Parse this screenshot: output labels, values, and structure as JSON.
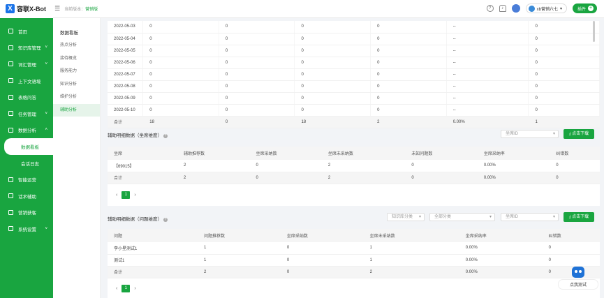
{
  "app": {
    "logo_mark": "X",
    "logo_text": "容联X-Bot",
    "crumb_label": "当前版本：",
    "crumb_version": "营销版"
  },
  "topbar": {
    "user": "xb营销六七",
    "button": "插件"
  },
  "sidebar": [
    {
      "label": "首页",
      "chev": false,
      "sub": false,
      "active": false
    },
    {
      "label": "知识库管理",
      "chev": true,
      "sub": false,
      "active": false
    },
    {
      "label": "词汇管理",
      "chev": true,
      "sub": false,
      "active": false
    },
    {
      "label": "上下文语境",
      "chev": false,
      "sub": false,
      "active": false
    },
    {
      "label": "表格问答",
      "chev": false,
      "sub": false,
      "active": false
    },
    {
      "label": "任务管理",
      "chev": true,
      "sub": false,
      "active": false
    },
    {
      "label": "数据分析",
      "chev": true,
      "sub": false,
      "active": false,
      "open": true
    },
    {
      "label": "数据看板",
      "chev": false,
      "sub": true,
      "active": true
    },
    {
      "label": "会话日志",
      "chev": false,
      "sub": true,
      "active": false
    },
    {
      "label": "智能运营",
      "chev": false,
      "sub": false,
      "active": false
    },
    {
      "label": "话术辅助",
      "chev": false,
      "sub": false,
      "active": false
    },
    {
      "label": "营销获客",
      "chev": false,
      "sub": false,
      "active": false
    },
    {
      "label": "系统设置",
      "chev": true,
      "sub": false,
      "active": false
    }
  ],
  "submenu": {
    "title": "数据看板",
    "items": [
      "热点分析",
      "接待概览",
      "服务能力",
      "知识分析",
      "维护分析",
      "辅助分析"
    ],
    "active_index": 5
  },
  "daily_table": {
    "rows": [
      [
        "2022-05-03",
        "0",
        "0",
        "0",
        "0",
        "--",
        "0"
      ],
      [
        "2022-05-04",
        "0",
        "0",
        "0",
        "0",
        "--",
        "0"
      ],
      [
        "2022-05-05",
        "0",
        "0",
        "0",
        "0",
        "--",
        "0"
      ],
      [
        "2022-05-06",
        "0",
        "0",
        "0",
        "0",
        "--",
        "0"
      ],
      [
        "2022-05-07",
        "0",
        "0",
        "0",
        "0",
        "--",
        "0"
      ],
      [
        "2022-05-08",
        "0",
        "0",
        "0",
        "0",
        "--",
        "0"
      ],
      [
        "2022-05-09",
        "0",
        "0",
        "0",
        "0",
        "--",
        "0"
      ],
      [
        "2022-05-10",
        "0",
        "0",
        "0",
        "0",
        "--",
        "0"
      ]
    ],
    "total": [
      "合计",
      "18",
      "0",
      "18",
      "2",
      "0.00%",
      "1"
    ]
  },
  "seat_section": {
    "title": "辅助明细数据（坐席维度）",
    "seat_select_placeholder": "坐席ID",
    "download": "点击下载",
    "headers": [
      "坐席",
      "辅助推荐数",
      "坐席采纳数",
      "坐席未采纳数",
      "未知问题数",
      "坐席采纳率",
      "纠错数"
    ],
    "rows": [
      [
        "【69015】",
        "2",
        "0",
        "2",
        "0",
        "0.00%",
        "0"
      ]
    ],
    "total": [
      "合计",
      "2",
      "0",
      "2",
      "0",
      "0.00%",
      "0"
    ],
    "page": "1"
  },
  "question_section": {
    "title": "辅助明细数据（问题维度）",
    "kb_select": "知识库分类",
    "cat_select": "全部分类",
    "seat_select_placeholder": "坐席ID",
    "download": "点击下载",
    "headers": [
      "问题",
      "问题推荐数",
      "坐席采纳数",
      "坐席未采纳数",
      "坐席采纳率",
      "纠错数"
    ],
    "rows": [
      [
        "李小星测试1",
        "1",
        "0",
        "1",
        "0.00%",
        "0"
      ],
      [
        "测试1",
        "1",
        "0",
        "1",
        "0.00%",
        "0"
      ]
    ],
    "total": [
      "合计",
      "2",
      "0",
      "2",
      "0.00%",
      "0"
    ],
    "page": "1"
  },
  "bot": {
    "label": "点我测试"
  },
  "colors": {
    "brand": "#19a540",
    "logo": "#1a73e8"
  }
}
